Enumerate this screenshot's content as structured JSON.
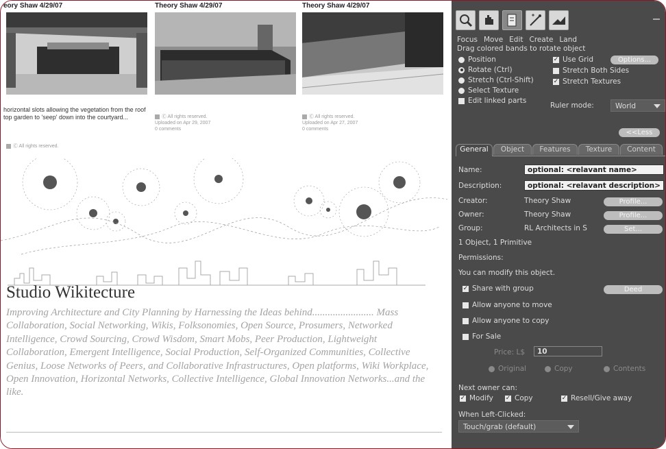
{
  "web": {
    "cards": [
      {
        "title": "eory Shaw 4/29/07",
        "caption": "horizontal slots allowing the vegetation from the roof top garden to 'seep' down into the courtyard...",
        "meta_lines": [
          "Ⓒ All rights reserved."
        ]
      },
      {
        "title": "Theory Shaw 4/29/07",
        "caption": "",
        "meta_lines": [
          "Ⓒ All rights reserved.",
          "Uploaded on Apr 29, 2007",
          "0 comments"
        ]
      },
      {
        "title": "Theory Shaw 4/29/07",
        "caption": "",
        "meta_lines": [
          "Ⓒ All rights reserved.",
          "Uploaded on Apr 27, 2007",
          "0 comments"
        ]
      }
    ],
    "heading": "Studio Wikitecture",
    "description": "Improving Architecture and City Planning by Harnessing the Ideas behind........................ Mass Collaboration, Social Networking, Wikis, Folksonomies, Open Source, Prosumers, Networked Intelligence, Crowd Sourcing, Crowd Wisdom, Smart Mobs, Peer Production, Lightweight Collaboration, Emergent Intelligence, Social Production, Self-Organized Communities, Collective Genius, Loose Networks of Peers, and Collaborative Infrastructures, Open platforms, Wiki Workplace, Open Innovation, Horizontal Networks, Collective Intelligence, Global Innovation Networks...and the like."
  },
  "panel": {
    "tool_labels": [
      "Focus",
      "Move",
      "Edit",
      "Create",
      "Land"
    ],
    "tool_icons": [
      "focus-icon",
      "move-hand-icon",
      "edit-icon",
      "create-wand-icon",
      "land-icon"
    ],
    "hint": "Drag colored bands to rotate object",
    "modes": [
      {
        "label": "Position",
        "selected": false
      },
      {
        "label": "Rotate (Ctrl)",
        "selected": true
      },
      {
        "label": "Stretch (Ctrl-Shift)",
        "selected": false
      },
      {
        "label": "Select Texture",
        "selected": false
      }
    ],
    "edit_linked": "Edit linked parts",
    "use_grid": "Use Grid",
    "options_btn": "Options...",
    "stretch_both": "Stretch Both Sides",
    "stretch_textures": "Stretch Textures",
    "ruler_mode_label": "Ruler mode:",
    "ruler_mode_value": "World",
    "less_btn": "<<Less",
    "tabs": [
      "General",
      "Object",
      "Features",
      "Texture",
      "Content"
    ],
    "active_tab": "General",
    "name_label": "Name:",
    "name_value": "optional: <relavant name>",
    "desc_label": "Description:",
    "desc_value": "optional: <relavant description>",
    "creator_label": "Creator:",
    "creator_value": "Theory Shaw",
    "owner_label": "Owner:",
    "owner_value": "Theory Shaw",
    "group_label": "Group:",
    "group_value": "RL Architects in S",
    "profile_btn": "Profile...",
    "set_btn": "Set...",
    "object_count": "1 Object, 1 Primitive",
    "permissions": "Permissions:",
    "can_modify": "You can modify this object.",
    "share_group": "Share with group",
    "deed_btn": "Deed",
    "allow_move": "Allow anyone to move",
    "allow_copy": "Allow anyone to copy",
    "for_sale": "For Sale",
    "price_label": "Price: L$",
    "price_value": "10",
    "sale_types": [
      "Original",
      "Copy",
      "Contents"
    ],
    "next_owner": "Next owner can:",
    "next_modify": "Modify",
    "next_copy": "Copy",
    "next_resell": "Resell/Give away",
    "when_clicked": "When Left-Clicked:",
    "click_action": "Touch/grab (default)"
  }
}
